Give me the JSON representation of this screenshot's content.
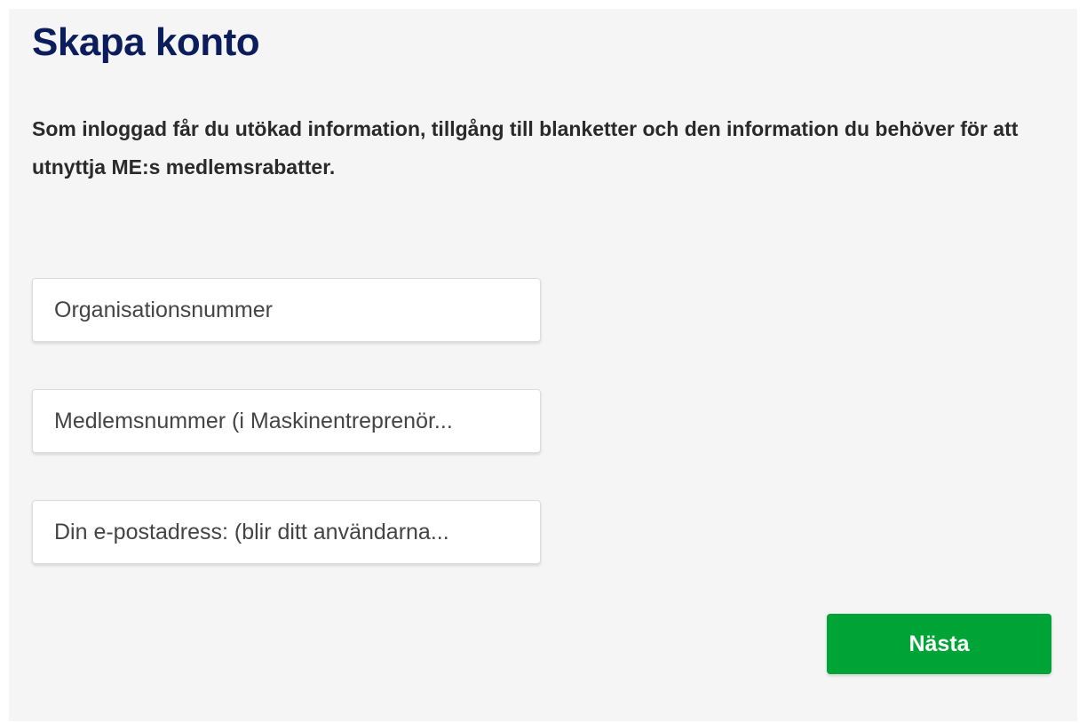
{
  "page": {
    "title": "Skapa konto",
    "intro": "Som inloggad får du utökad information, tillgång till blanketter och den information du behöver för att utnyttja ME:s medlemsrabatter."
  },
  "form": {
    "fields": [
      {
        "value": "",
        "placeholder": "Organisationsnummer"
      },
      {
        "value": "",
        "placeholder": "Medlemsnummer (i Maskinentreprenör..."
      },
      {
        "value": "",
        "placeholder": "Din e-postadress: (blir ditt användarna..."
      }
    ],
    "submit_label": "Nästa"
  },
  "colors": {
    "title": "#0c1d5c",
    "panel_background": "#f5f5f5",
    "button_background": "#00a335",
    "button_text": "#ffffff"
  }
}
